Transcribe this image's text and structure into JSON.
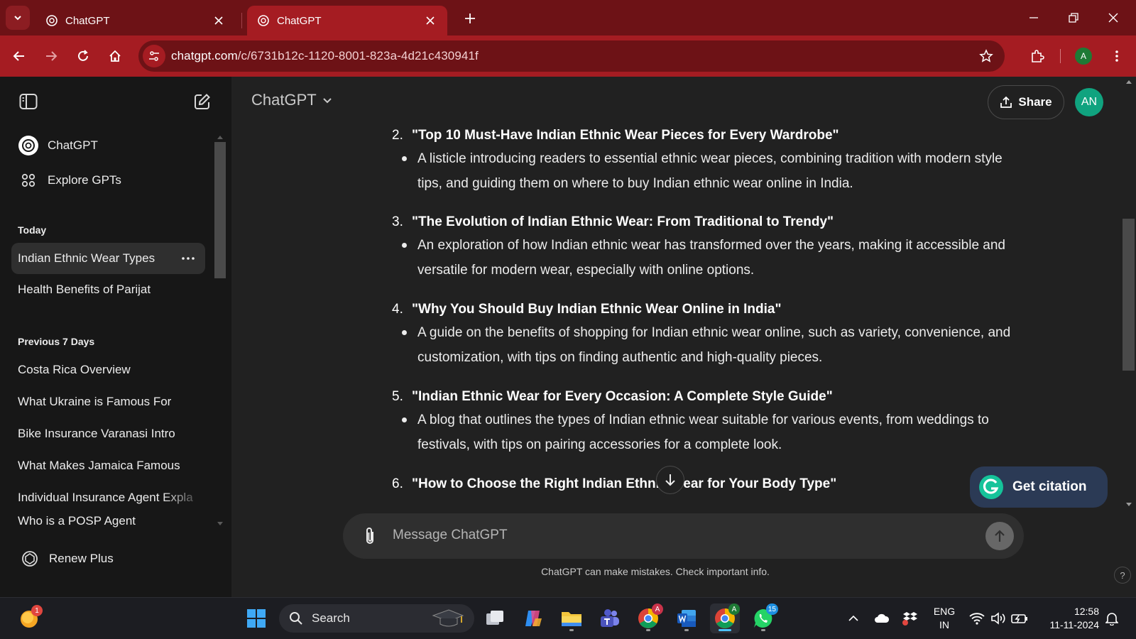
{
  "browser": {
    "tabs": [
      {
        "title": "ChatGPT",
        "active": false
      },
      {
        "title": "ChatGPT",
        "active": true
      }
    ],
    "url_host": "chatgpt.com",
    "url_path": "/c/6731b12c-1120-8001-823a-4d21c430941f",
    "profile_initial": "A"
  },
  "sidebar": {
    "nav": [
      {
        "label": "ChatGPT",
        "icon": "openai-logo-icon"
      },
      {
        "label": "Explore GPTs",
        "icon": "grid-icon"
      }
    ],
    "sections": [
      {
        "title": "Today",
        "items": [
          {
            "label": "Indian Ethnic Wear Types",
            "active": true
          },
          {
            "label": "Health Benefits of Parijat",
            "active": false
          }
        ]
      },
      {
        "title": "Previous 7 Days",
        "items": [
          {
            "label": "Costa Rica Overview"
          },
          {
            "label": "What Ukraine is Famous For"
          },
          {
            "label": "Bike Insurance Varanasi Intro"
          },
          {
            "label": "What Makes Jamaica Famous"
          },
          {
            "label": "Individual Insurance Agent Expla"
          },
          {
            "label": "Who is a POSP Agent"
          }
        ]
      }
    ],
    "renew_label": "Renew Plus"
  },
  "header": {
    "model": "ChatGPT",
    "share_label": "Share",
    "user_initials": "AN"
  },
  "chat": {
    "points": [
      {
        "num": "2.",
        "title": "\"Top 10 Must-Have Indian Ethnic Wear Pieces for Every Wardrobe\"",
        "desc": "A listicle introducing readers to essential ethnic wear pieces, combining tradition with modern style tips, and guiding them on where to buy Indian ethnic wear online in India."
      },
      {
        "num": "3.",
        "title": "\"The Evolution of Indian Ethnic Wear: From Traditional to Trendy\"",
        "desc": "An exploration of how Indian ethnic wear has transformed over the years, making it accessible and versatile for modern wear, especially with online options."
      },
      {
        "num": "4.",
        "title": "\"Why You Should Buy Indian Ethnic Wear Online in India\"",
        "desc": "A guide on the benefits of shopping for Indian ethnic wear online, such as variety, convenience, and customization, with tips on finding authentic and high-quality pieces."
      },
      {
        "num": "5.",
        "title": "\"Indian Ethnic Wear for Every Occasion: A Complete Style Guide\"",
        "desc": "A blog that outlines the types of Indian ethnic wear suitable for various events, from weddings to festivals, with tips on pairing accessories for a complete look."
      },
      {
        "num": "6.",
        "title": "\"How to Choose the Right Indian Ethnic Wear for Your Body Type\"",
        "desc": ""
      }
    ]
  },
  "composer": {
    "placeholder": "Message ChatGPT",
    "disclaimer": "ChatGPT can make mistakes. Check important info.",
    "help": "?"
  },
  "citation": {
    "label": "Get citation"
  },
  "taskbar": {
    "search_label": "Search",
    "notification_badge": "1",
    "chrome_badge": "A",
    "whatsapp_badge": "15",
    "language_line1": "ENG",
    "language_line2": "IN",
    "time": "12:58",
    "date": "11-11-2024"
  },
  "colors": {
    "tab_strip": "#6d1216",
    "toolbar": "#a51c22",
    "sidebar_bg": "#171717",
    "main_bg": "#212121",
    "accent_green": "#10a37f",
    "citation_bg": "#2b3a55"
  }
}
